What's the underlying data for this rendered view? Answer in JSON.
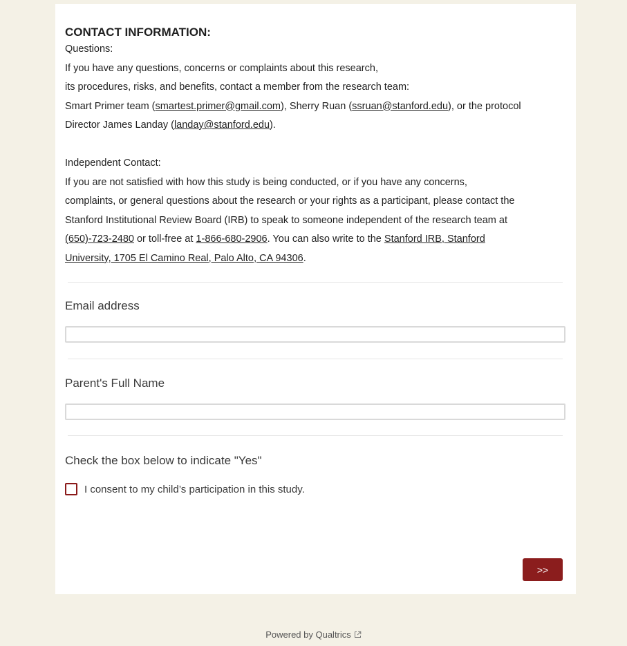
{
  "contact": {
    "heading": "CONTACT INFORMATION:",
    "questions_label": "Questions:",
    "questions_line1": "If you have any questions, concerns or complaints about this research,",
    "questions_line2": "its procedures, risks, and benefits, contact a member from the research team:",
    "team_prefix": "Smart Primer team (",
    "team_email": "smartest.primer@gmail.com",
    "sherry_prefix": "), Sherry Ruan (",
    "sherry_email": "ssruan@stanford.edu",
    "protocol_text": "), or the protocol",
    "director_prefix": "Director James Landay (",
    "director_email": "landay@stanford.edu",
    "director_suffix": ").",
    "independent_label": "Independent Contact:",
    "independent_line1": "If you are not satisfied with how this study is being conducted, or if you have any concerns,",
    "independent_line2": "complaints, or general questions about the research or your rights as a participant, please contact the",
    "independent_line3": "Stanford Institutional Review Board (IRB) to speak to someone independent of the research team at",
    "irb_phone": "(650)-723-2480",
    "tollfree_text": " or toll-free at ",
    "tollfree_phone": "1-866-680-2906",
    "write_text": ". You can also write to the ",
    "irb_address_part1": "Stanford IRB, Stanford ",
    "irb_address_part2": "University, 1705 El Camino Real, Palo Alto, CA 94306",
    "address_suffix": "."
  },
  "form": {
    "email_label": "Email address",
    "email_value": "",
    "parent_label": "Parent's Full Name",
    "parent_value": "",
    "check_label": "Check the box below to indicate \"Yes\"",
    "consent_label": "I consent to my child’s participation in this study.",
    "consent_checked": false
  },
  "navigation": {
    "next_label": ">>"
  },
  "footer": {
    "powered_by": "Powered by Qualtrics"
  },
  "colors": {
    "accent": "#8b1d1d",
    "page_background": "#f4f1e6"
  }
}
